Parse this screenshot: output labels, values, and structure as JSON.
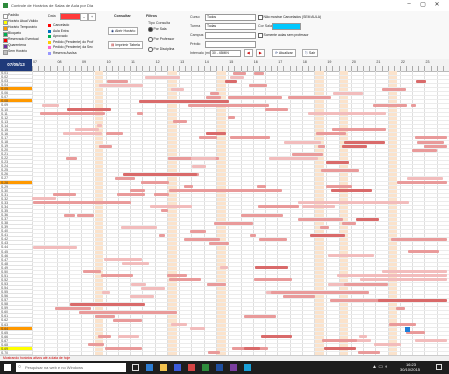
{
  "window": {
    "title": "Controle de Horários de Salas de Aula por Dia",
    "controls": {
      "minimize": "–",
      "maximize": "▢",
      "close": "✕"
    }
  },
  "legend": {
    "items": [
      {
        "label": "Padrão",
        "color": "#ffffff"
      },
      {
        "label": "Horário Atual Válido",
        "color": "#ffff00"
      },
      {
        "label": "Horário Temporário",
        "color": "#ff9900"
      },
      {
        "label": "Bloqueio",
        "color": "#00b050"
      },
      {
        "label": "Reservado Eventual",
        "color": "#ff0000"
      },
      {
        "label": "Quarentena",
        "color": "#7030a0"
      },
      {
        "label": "Sem Horário",
        "color": "#c0c0c0"
      }
    ],
    "col2": [
      {
        "label": "Cancelado",
        "color": "#ff0000"
      },
      {
        "label": "Aula Extra",
        "color": "#0070c0"
      },
      {
        "label": "Aprovado",
        "color": "#00b050"
      },
      {
        "label": "Pedido (Pendente) do Prof",
        "color": "#ffcc00"
      },
      {
        "label": "Pedido (Pendente) da Sec",
        "color": "#ff66cc"
      },
      {
        "label": "Reserva Avulsa",
        "color": "#9999ff"
      }
    ]
  },
  "ribbon": {
    "date_label": "Data",
    "nav": {
      "prev": "–",
      "next": "+"
    },
    "consultar_label": "Consultar",
    "btn_view": "Abrir Horário",
    "btn_print": "Imprimir Tabela",
    "group_filters": "Filtros",
    "tipo_label": "Tipo Consulta",
    "radios": [
      "Por Sala",
      "Por Professor",
      "Por Disciplina"
    ],
    "curso_label": "Curso",
    "curso_value": "Todos",
    "turma_label": "Turma",
    "turma_value": "Todas",
    "campus_label": "Campus",
    "campus_value": "",
    "predio_label": "Prédio",
    "predio_value": "",
    "check_hide": "Não mostrar Cancelados (SEM AULA)",
    "check_only": "Somente aulas sem professor",
    "cor_sala_label": "Cor Sala",
    "cor_sala_value": "",
    "intervalo_label": "Intervalo (min)",
    "intervalo_value": "30 - 45MIN",
    "btn_refresh": "Atualizar",
    "btn_exit": "Sair"
  },
  "grid": {
    "date": "07/05/13",
    "columns": [
      "07",
      "08",
      "09",
      "10",
      "11",
      "12",
      "13",
      "14",
      "15",
      "16",
      "17",
      "18",
      "19",
      "20",
      "21",
      "22",
      "23"
    ],
    "rows": [
      "S.01",
      "S.02",
      "S.03",
      "S.04",
      "S.05",
      "S.06",
      "S.07",
      "S.08",
      "S.09",
      "S.10",
      "S.11",
      "S.12",
      "S.13",
      "S.14",
      "S.15",
      "S.16",
      "S.17",
      "S.18",
      "S.19",
      "S.20",
      "S.21",
      "S.22",
      "S.23",
      "S.24",
      "S.25",
      "S.26",
      "S.27",
      "S.28",
      "S.29",
      "S.30",
      "S.31",
      "S.32",
      "S.33",
      "S.34",
      "S.35",
      "S.36",
      "S.37",
      "S.38",
      "S.39",
      "S.40",
      "S.41",
      "S.42",
      "S.43",
      "S.44",
      "S.45",
      "S.46",
      "S.47",
      "S.48",
      "S.49",
      "S.50",
      "S.51",
      "S.52",
      "S.53",
      "S.54",
      "S.55",
      "S.56",
      "S.57",
      "S.58",
      "S.59",
      "S.60",
      "S.61",
      "S.62",
      "S.63",
      "S.64",
      "S.65",
      "S.66",
      "S.67",
      "S.68",
      "S.69",
      "S.70"
    ],
    "highlight_rows": {
      "4": "#ff9900",
      "7": "#ff9900",
      "27": "#ff9900",
      "63": "#ff9900",
      "68": "#ffff00"
    }
  },
  "statusbar": {
    "text": "Mostrando horários ativos até a data de hoje"
  },
  "taskbar": {
    "search_placeholder": "Pesquisar na web e no Windows",
    "time": "16:23",
    "date": "30/10/2015"
  },
  "colors": {
    "accent": "#1f3a7a",
    "bar": "#e99a9a",
    "shade": "#fbe3cc"
  }
}
